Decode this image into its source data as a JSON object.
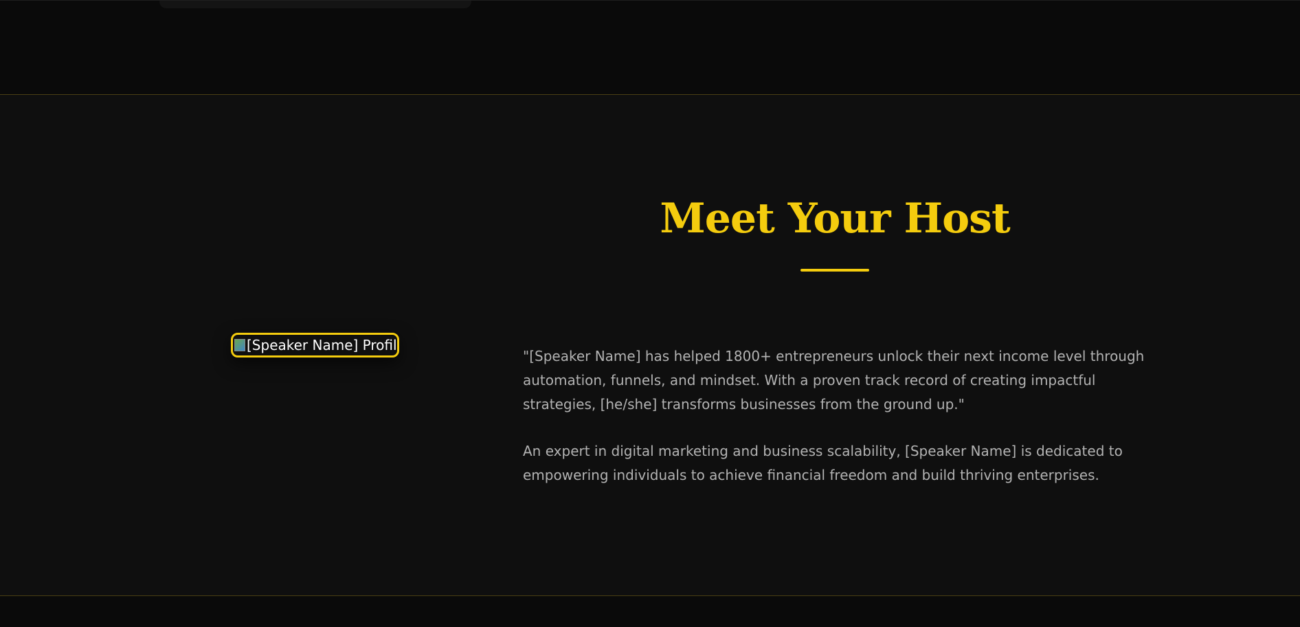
{
  "host": {
    "title": "Meet Your Host",
    "profile_image_alt": "[Speaker Name] Profile",
    "bio_quote": "\"[Speaker Name] has helped 1800+ entrepreneurs unlock their next income level through automation, funnels, and mindset. With a proven track record of creating impactful strategies, [he/she] transforms businesses from the ground up.\"",
    "bio_detail": "An expert in digital marketing and business scalability, [Speaker Name] is dedicated to empowering individuals to achieve financial freedom and build thriving enterprises."
  },
  "colors": {
    "accent": "#f4cc0e",
    "background": "#0f0f0f",
    "text_muted": "#b3b3b3"
  },
  "icons": {
    "profile_image": "broken-image-icon"
  }
}
